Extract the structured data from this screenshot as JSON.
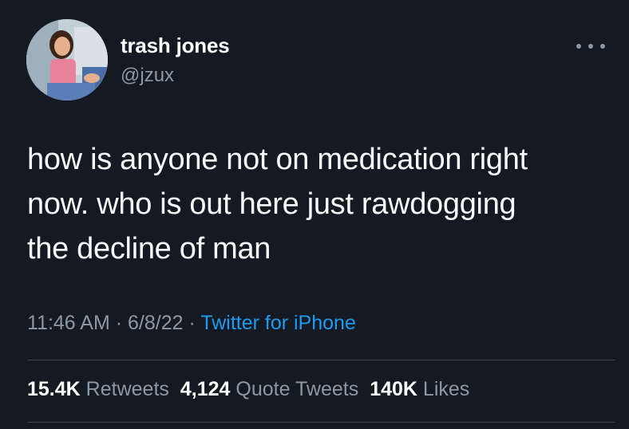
{
  "tweet": {
    "author": {
      "name": "trash jones",
      "handle": "@jzux"
    },
    "text": "how is anyone not on medication right\nnow. who is out here just rawdogging\nthe decline of man",
    "time": "11:46 AM",
    "date": "6/8/22",
    "separator": "·",
    "source": "Twitter for iPhone",
    "stats": {
      "retweets_count": "15.4K",
      "retweets_label": "Retweets",
      "quote_tweets_count": "4,124",
      "quote_tweets_label": "Quote Tweets",
      "likes_count": "140K",
      "likes_label": "Likes"
    },
    "colors": {
      "background": "#151a22",
      "text": "#f7f9f9",
      "secondary_text": "#8b98a5",
      "link": "#1d9bf0",
      "divider": "#38444d"
    }
  }
}
